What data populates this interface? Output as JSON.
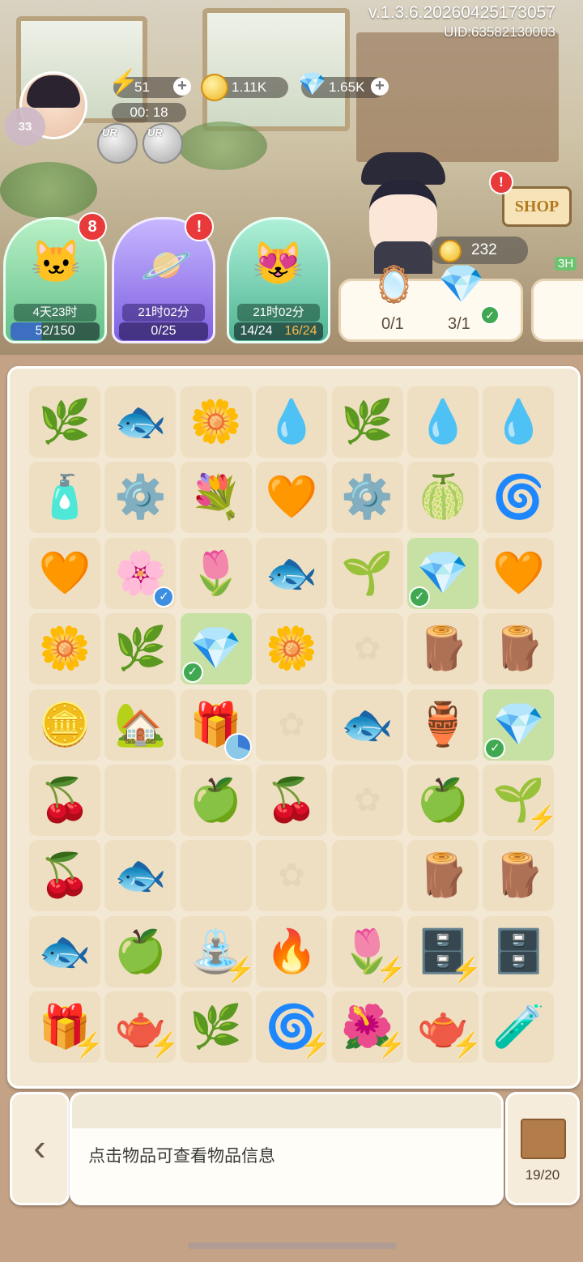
{
  "header": {
    "version": "v.1.3.6.20260425173057",
    "uid": "UID:63582130003",
    "level": "33",
    "energy": "51",
    "energy_timer": "00: 18",
    "coins": "1.11K",
    "gems": "1.65K",
    "ur_label": "UR"
  },
  "events": [
    {
      "time": "4天23时",
      "progress": "52/150",
      "badge": "8",
      "icon": "cat-cloud-icon",
      "color": "#8fd9a8"
    },
    {
      "time": "21时02分",
      "progress": "0/25",
      "badge": "!",
      "icon": "planet-icon",
      "color": "#9e86e8"
    },
    {
      "time": "21时02分",
      "progress_a": "14/24",
      "progress_b": "16/24",
      "icon": "cats-heart-icon",
      "color": "#7fd0b6"
    }
  ],
  "shop": {
    "label": "SHOP",
    "badge": "!"
  },
  "customer": {
    "coins": "232",
    "order_items": [
      {
        "icon": "compact-mirror-icon",
        "count": "0/1"
      },
      {
        "icon": "purple-crystal-icon",
        "count": "3/1",
        "done": true
      }
    ],
    "next_order_timer": "3H"
  },
  "board": {
    "rows": [
      [
        {
          "i": "🌿",
          "n": "glass-dome-plant-blue-icon"
        },
        {
          "i": "🐟",
          "n": "goldfish-icon"
        },
        {
          "i": "🌼",
          "n": "yellow-ylang-flower-icon"
        },
        {
          "i": "💧",
          "n": "purple-droplet-icon"
        },
        {
          "i": "🌿",
          "n": "glass-dome-plant-blue-icon"
        },
        {
          "i": "💧",
          "n": "water-droplet-icon"
        },
        {
          "i": "💧",
          "n": "purple-droplet-icon"
        }
      ],
      [
        {
          "i": "🧴",
          "n": "perfume-bottle-icon"
        },
        {
          "i": "⚙️",
          "n": "stone-medallion-icon"
        },
        {
          "i": "💐",
          "n": "yellow-flower-bouquet-icon"
        },
        {
          "i": "🧡",
          "n": "orange-droplet-icon"
        },
        {
          "i": "⚙️",
          "n": "dragonfly-medallion-icon"
        },
        {
          "i": "🍈",
          "n": "lime-slime-icon"
        },
        {
          "i": "🌀",
          "n": "wave-medallion-icon"
        }
      ],
      [
        {
          "i": "🧡",
          "n": "orange-droplet-icon"
        },
        {
          "i": "🌸",
          "n": "osmanthus-branch-icon",
          "check": "blue"
        },
        {
          "i": "🌷",
          "n": "white-lily-icon"
        },
        {
          "i": "🐟",
          "n": "goldfish-icon"
        },
        {
          "i": "🌱",
          "n": "glass-dome-vine-icon"
        },
        {
          "i": "💎",
          "n": "purple-crystal-icon",
          "sel": true,
          "check": "green"
        },
        {
          "i": "🧡",
          "n": "orange-droplet-icon"
        }
      ],
      [
        {
          "i": "🌼",
          "n": "yellow-flowers-icon"
        },
        {
          "i": "🌿",
          "n": "glass-dome-plant-blue-icon"
        },
        {
          "i": "💎",
          "n": "purple-crystal-icon",
          "sel": true,
          "check": "green"
        },
        {
          "i": "🌼",
          "n": "yellow-flowers-icon"
        },
        {
          "i": "",
          "n": "empty-cell"
        },
        {
          "i": "🪵",
          "n": "wood-logs-icon"
        },
        {
          "i": "🪵",
          "n": "wood-logs-icon"
        }
      ],
      [
        {
          "i": "🪙",
          "n": "coin-stack-icon"
        },
        {
          "i": "🏡",
          "n": "garden-arbor-icon"
        },
        {
          "i": "🎁",
          "n": "gift-box-icon",
          "pie": true
        },
        {
          "i": "",
          "n": "empty-cell"
        },
        {
          "i": "🐟",
          "n": "goldfish-icon"
        },
        {
          "i": "🏺",
          "n": "glass-vase-icon"
        },
        {
          "i": "💎",
          "n": "purple-crystal-icon",
          "sel": true,
          "check": "green"
        }
      ],
      [
        {
          "i": "🍒",
          "n": "red-berries-icon"
        },
        {
          "i": "",
          "n": "empty-cell",
          "blank": true
        },
        {
          "i": "🍏",
          "n": "green-berries-icon"
        },
        {
          "i": "🍒",
          "n": "red-berries-icon"
        },
        {
          "i": "",
          "n": "empty-cell"
        },
        {
          "i": "🍏",
          "n": "green-berries-icon"
        },
        {
          "i": "🌱",
          "n": "seedling-planter-icon",
          "bolt": true
        }
      ],
      [
        {
          "i": "🍒",
          "n": "red-berries-icon"
        },
        {
          "i": "🐟",
          "n": "goldfish-icon"
        },
        {
          "i": "",
          "n": "empty-cell",
          "blank": true
        },
        {
          "i": "",
          "n": "empty-cell"
        },
        {
          "i": "",
          "n": "empty-cell",
          "blank": true
        },
        {
          "i": "🪵",
          "n": "wood-logs-icon"
        },
        {
          "i": "🪵",
          "n": "wood-logs-icon"
        }
      ],
      [
        {
          "i": "🐟",
          "n": "goldfish-icon"
        },
        {
          "i": "🍏",
          "n": "green-berries-icon"
        },
        {
          "i": "⛲",
          "n": "fountain-garden-icon",
          "bolt": true
        },
        {
          "i": "🔥",
          "n": "campfire-icon"
        },
        {
          "i": "🌷",
          "n": "flower-planter-icon",
          "bolt": true
        },
        {
          "i": "🗄️",
          "n": "display-shelf-icon",
          "bolt": true
        },
        {
          "i": "🗄️",
          "n": "wooden-cabinet-icon"
        }
      ],
      [
        {
          "i": "🎁",
          "n": "treasure-chest-icon",
          "bolt": true
        },
        {
          "i": "🫖",
          "n": "copper-teapot-icon",
          "bolt": true
        },
        {
          "i": "🌿",
          "n": "glass-dome-plant-green-icon"
        },
        {
          "i": "🌀",
          "n": "purple-vortex-icon",
          "bolt": true
        },
        {
          "i": "🌺",
          "n": "flower-planter-pink-icon",
          "bolt": true
        },
        {
          "i": "🫖",
          "n": "tea-kettle-icon",
          "bolt": true
        },
        {
          "i": "🧪",
          "n": "golden-potion-icon"
        }
      ]
    ]
  },
  "footer": {
    "back_icon": "chevron-left-icon",
    "info_text": "点击物品可查看物品信息",
    "bag_count": "19/20"
  }
}
